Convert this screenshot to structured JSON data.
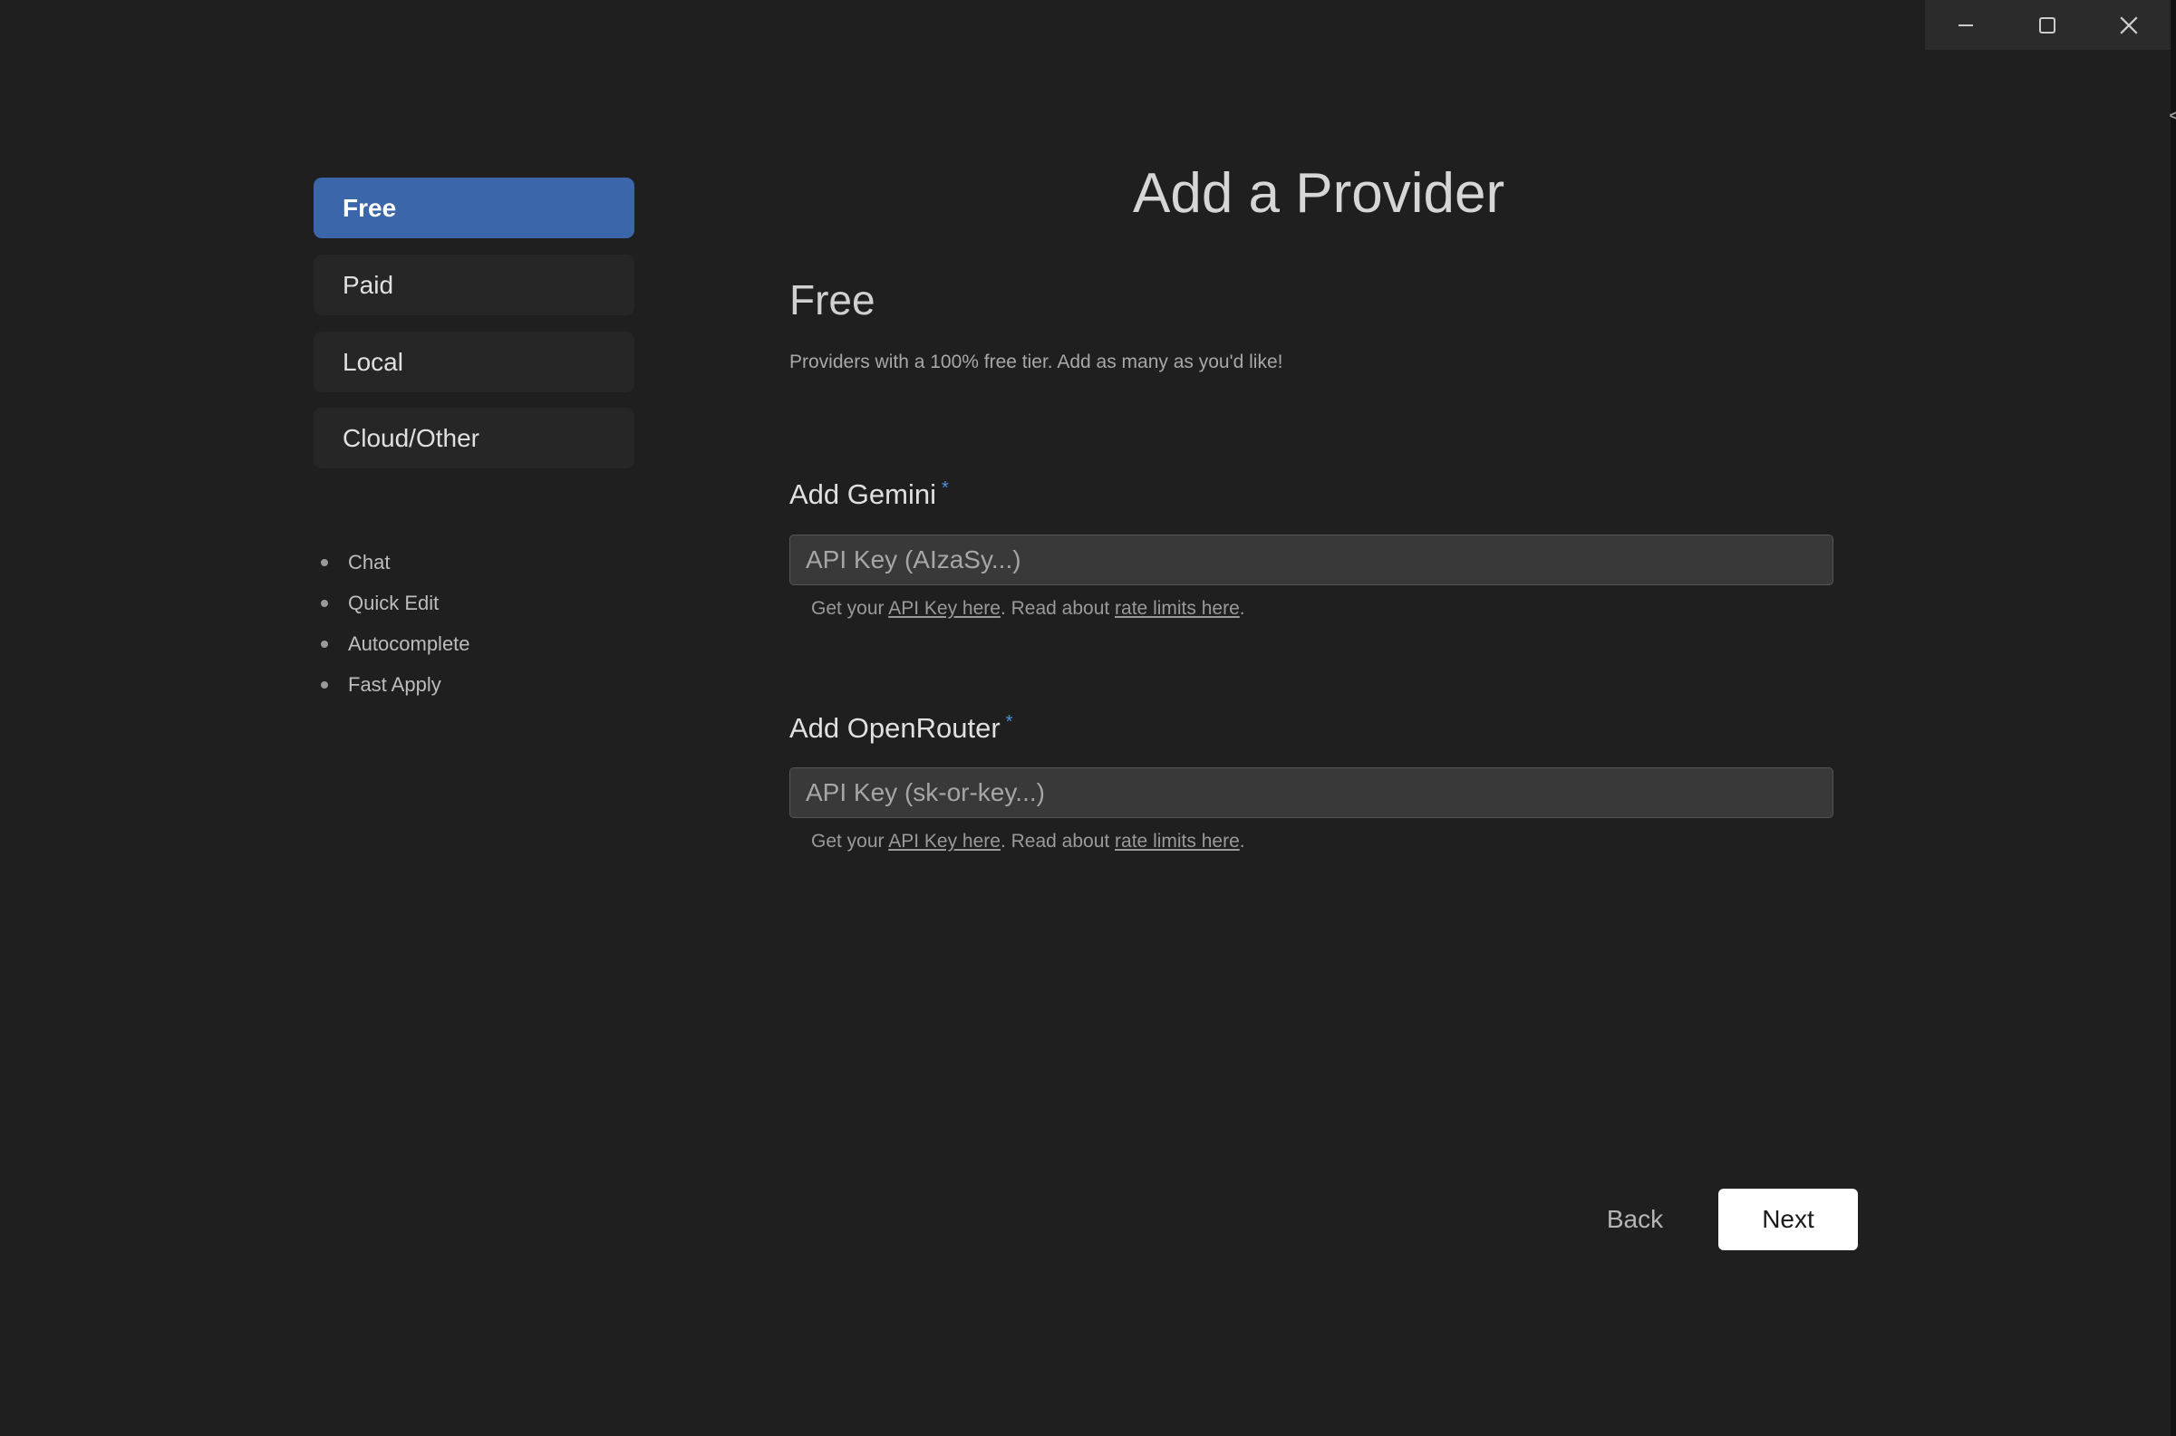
{
  "window": {
    "controls": [
      "minimize",
      "maximize",
      "close"
    ],
    "edge_glyph": "<"
  },
  "sidebar": {
    "tabs": [
      {
        "label": "Free",
        "active": true
      },
      {
        "label": "Paid",
        "active": false
      },
      {
        "label": "Local",
        "active": false
      },
      {
        "label": "Cloud/Other",
        "active": false
      }
    ],
    "features": [
      "Chat",
      "Quick Edit",
      "Autocomplete",
      "Fast Apply"
    ]
  },
  "main": {
    "title": "Add a Provider",
    "section_title": "Free",
    "section_description": "Providers with a 100% free tier. Add as many as you'd like!",
    "providers": [
      {
        "label": "Add Gemini",
        "required_mark": "*",
        "placeholder": "API Key (AIzaSy...)",
        "value": "",
        "hint_prefix": "Get your ",
        "hint_link1": "API Key here",
        "hint_middle": ". Read about ",
        "hint_link2": "rate limits here",
        "hint_suffix": "."
      },
      {
        "label": "Add OpenRouter",
        "required_mark": "*",
        "placeholder": "API Key (sk-or-key...)",
        "value": "",
        "hint_prefix": "Get your ",
        "hint_link1": "API Key here",
        "hint_middle": ". Read about ",
        "hint_link2": "rate limits here",
        "hint_suffix": "."
      }
    ]
  },
  "footer": {
    "back_label": "Back",
    "next_label": "Next"
  },
  "colors": {
    "background": "#1f1f1f",
    "active_tab": "#3b67aa",
    "required_mark": "#4c8fe0",
    "next_button": "#ffffff"
  }
}
